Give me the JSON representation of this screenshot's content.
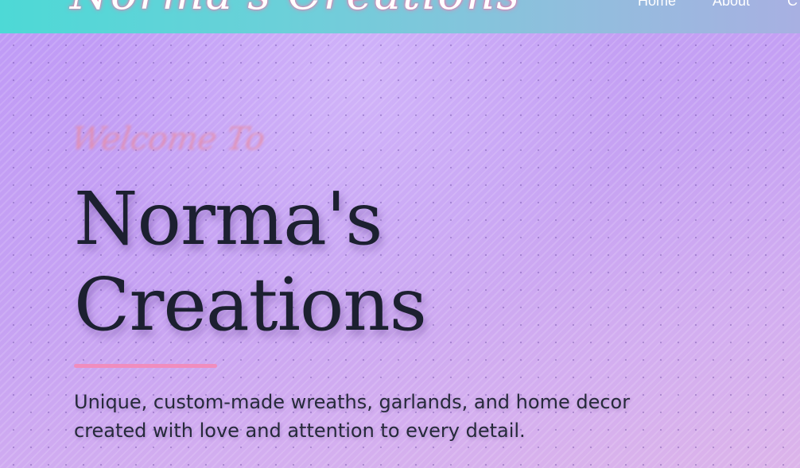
{
  "header": {
    "logo_text": "Norma's Creations",
    "nav": {
      "home": "Home",
      "about": "About",
      "contact": "C"
    }
  },
  "hero": {
    "welcome": "Welcome To",
    "title_line1": "Norma's",
    "title_line2": "Creations",
    "tagline": "Unique, custom-made wreaths, garlands, and home decor created with love and attention to every detail."
  },
  "colors": {
    "header_gradient_start": "#4dd9d6",
    "header_gradient_end": "#a8b0e2",
    "hero_background": "#c6a2f3",
    "title_text": "#1c2030",
    "accent_underline": "#f08dbe",
    "welcome_script": "#e98aa0"
  }
}
